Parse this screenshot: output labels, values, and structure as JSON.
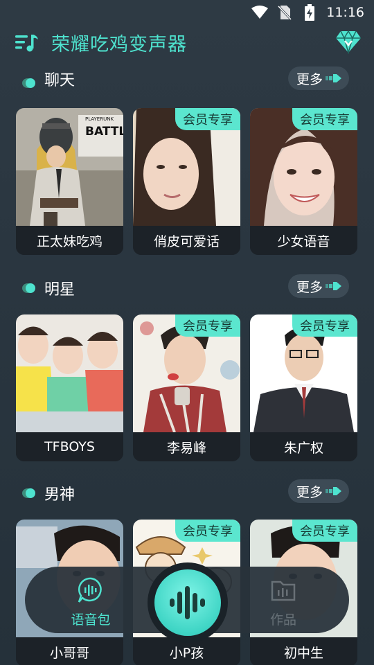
{
  "status_bar": {
    "time": "11:16"
  },
  "header": {
    "title": "荣耀吃鸡变声器"
  },
  "sections": [
    {
      "title": "聊天",
      "more_label": "更多",
      "cards": [
        {
          "name": "正太妹吃鸡",
          "badge": ""
        },
        {
          "name": "俏皮可爱话",
          "badge": "会员专享"
        },
        {
          "name": "少女语音",
          "badge": "会员专享"
        }
      ]
    },
    {
      "title": "明星",
      "more_label": "更多",
      "cards": [
        {
          "name": "TFBOYS",
          "badge": ""
        },
        {
          "name": "李易峰",
          "badge": "会员专享"
        },
        {
          "name": "朱广权",
          "badge": "会员专享"
        }
      ]
    },
    {
      "title": "男神",
      "more_label": "更多",
      "cards": [
        {
          "name": "小哥哥",
          "badge": ""
        },
        {
          "name": "小P孩",
          "badge": "会员专享"
        },
        {
          "name": "初中生",
          "badge": "会员专享"
        }
      ]
    }
  ],
  "card0_image_text": "BATTLEG",
  "card0_image_small_text": "PLAYERUNK",
  "bottom_nav": {
    "voice_label": "语音包",
    "works_label": "作品"
  },
  "colors": {
    "accent": "#4ee3cf",
    "badge_bg": "#5be6cf",
    "background": "#2a3640"
  }
}
